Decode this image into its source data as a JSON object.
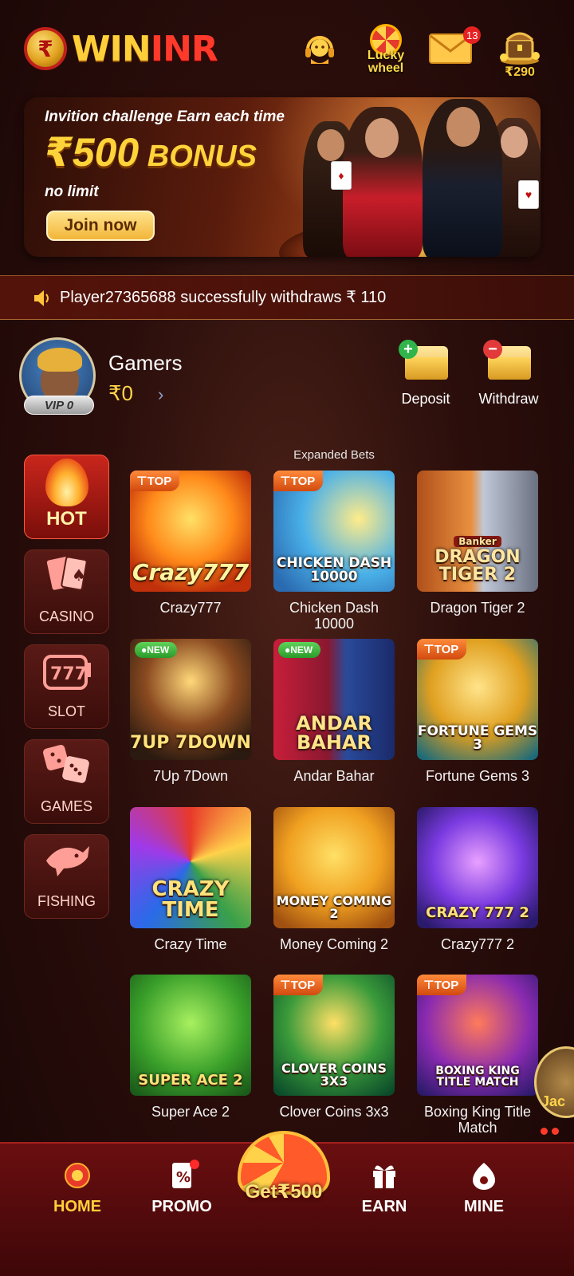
{
  "header": {
    "logo_symbol": "₹",
    "logo_win": "WIN",
    "logo_inr": "INR",
    "support_icon": "headset-icon",
    "lucky_label_line1": "Lucky",
    "lucky_label_line2": "wheel",
    "mail_badge": "13",
    "chest_amount": "₹290"
  },
  "banner": {
    "line1": "Invition challenge Earn each time",
    "amount": "₹500",
    "bonus": " BONUS",
    "line3": "no limit",
    "join_label": "Join now"
  },
  "marquee": {
    "text": "Player27365688 successfully withdraws ₹ 110"
  },
  "user": {
    "name": "Gamers",
    "balance": "₹0",
    "vip": "VIP 0",
    "deposit_label": "Deposit",
    "withdraw_label": "Withdraw"
  },
  "categories": [
    {
      "label": "HOT",
      "active": true
    },
    {
      "label": "CASINO",
      "active": false
    },
    {
      "label": "SLOT",
      "active": false
    },
    {
      "label": "GAMES",
      "active": false
    },
    {
      "label": "FISHING",
      "active": false
    }
  ],
  "partial_label": "Expanded Bets",
  "games": [
    {
      "name": "Crazy777",
      "thumb_title": "Crazy777",
      "tag": "TOP"
    },
    {
      "name": "Chicken Dash 10000",
      "thumb_title": "CHICKEN DASH 10000",
      "tag": "TOP"
    },
    {
      "name": "Dragon Tiger 2",
      "thumb_title": "DRAGON TIGER 2",
      "tag": ""
    },
    {
      "name": "7Up 7Down",
      "thumb_title": "7UP 7DOWN",
      "tag": "NEW"
    },
    {
      "name": "Andar Bahar",
      "thumb_title": "ANDAR BAHAR",
      "tag": "NEW"
    },
    {
      "name": "Fortune Gems 3",
      "thumb_title": "FORTUNE GEMS 3",
      "tag": "TOP"
    },
    {
      "name": "Crazy Time",
      "thumb_title": "CRAZY TIME",
      "tag": ""
    },
    {
      "name": "Money Coming 2",
      "thumb_title": "MONEY COMING 2",
      "tag": ""
    },
    {
      "name": "Crazy777 2",
      "thumb_title": "CRAZY 777 2",
      "tag": ""
    },
    {
      "name": "Super Ace 2",
      "thumb_title": "SUPER ACE 2",
      "tag": ""
    },
    {
      "name": "Clover Coins 3x3",
      "thumb_title": "CLOVER COINS 3X3",
      "tag": "TOP"
    },
    {
      "name": "Boxing King Title Match",
      "thumb_title": "BOXING KING TITLE MATCH",
      "tag": "TOP"
    }
  ],
  "dragon_banker": "Banker",
  "jackpot_text": "Jac",
  "bottom_nav": {
    "home": "HOME",
    "promo": "PROMO",
    "center": "Get₹500",
    "earn": "EARN",
    "mine": "MINE"
  },
  "colors": {
    "accent_gold": "#ffcf3a",
    "brand_red": "#c9261c",
    "background": "#2b0e0b"
  }
}
